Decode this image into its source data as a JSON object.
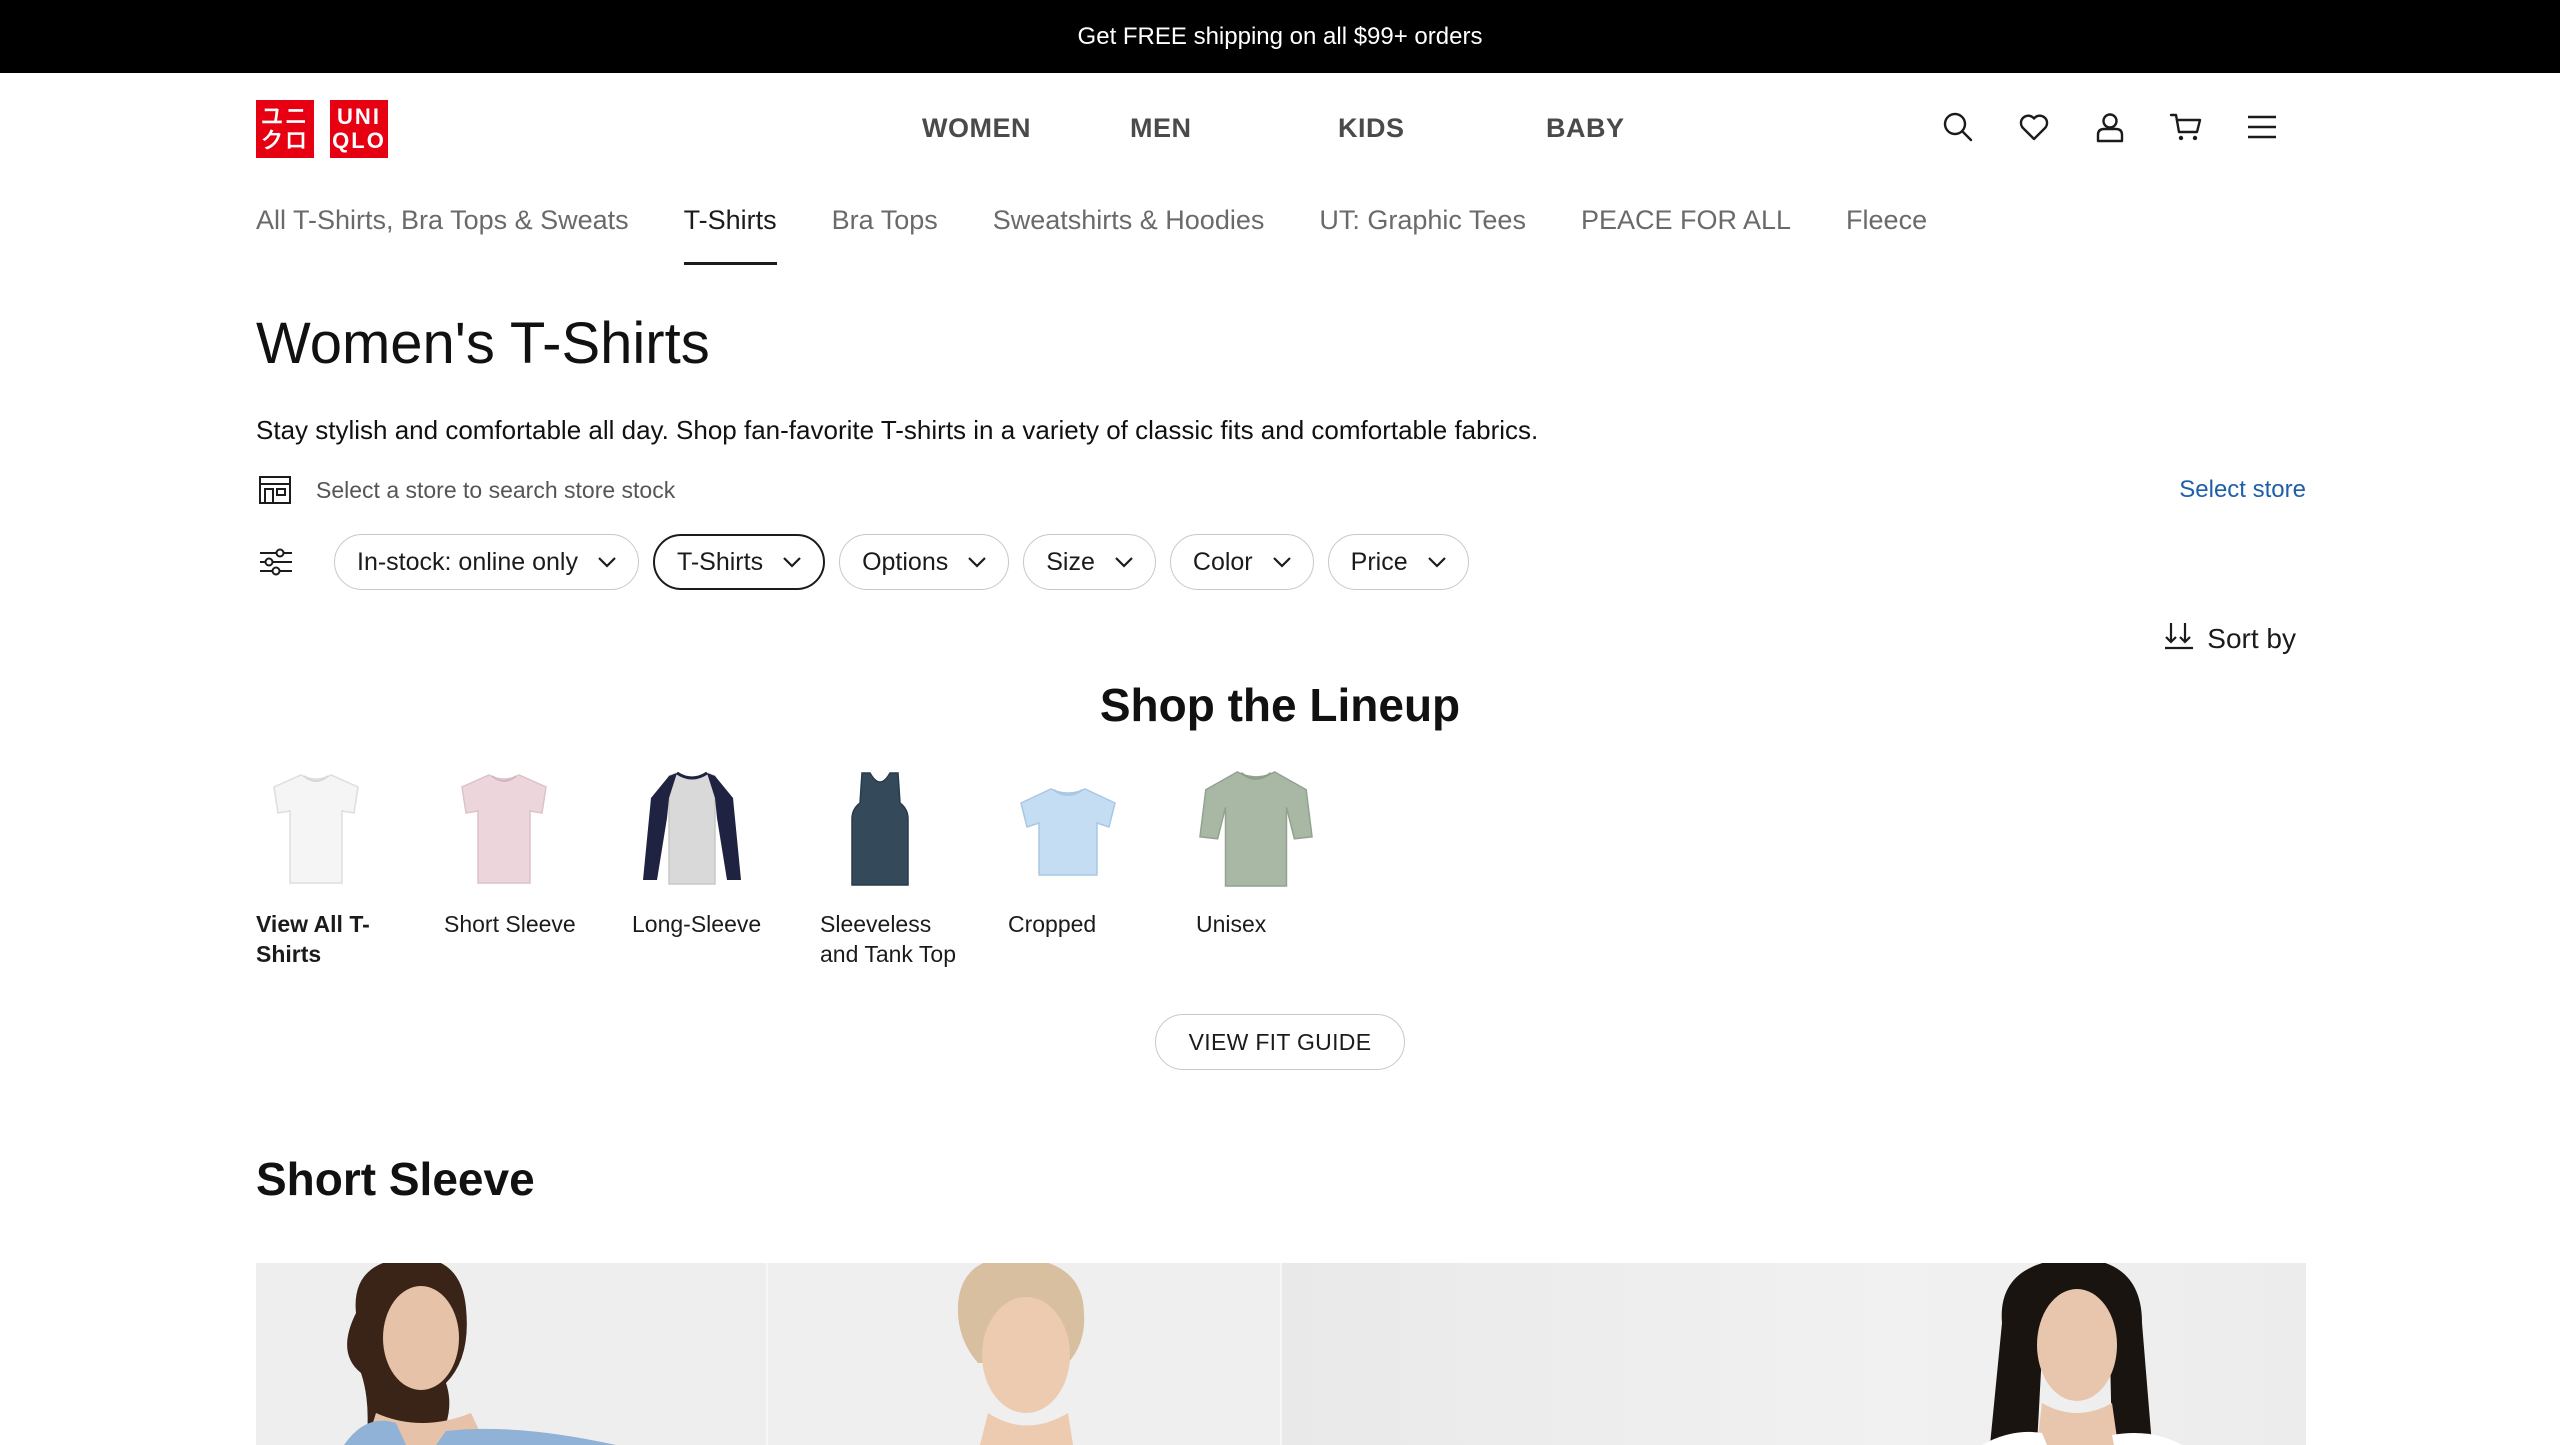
{
  "promo": {
    "text": "Get FREE shipping on all $99+ orders"
  },
  "logo": {
    "block1": [
      "ユニ",
      "クロ"
    ],
    "block2": [
      "UNI",
      "QLO"
    ]
  },
  "main_nav": [
    "WOMEN",
    "MEN",
    "KIDS",
    "BABY"
  ],
  "header_icons": [
    "search-icon",
    "heart-icon",
    "account-icon",
    "cart-icon",
    "menu-icon"
  ],
  "sub_nav": {
    "items": [
      "All T-Shirts, Bra Tops & Sweats",
      "T-Shirts",
      "Bra Tops",
      "Sweatshirts & Hoodies",
      "UT: Graphic Tees",
      "PEACE FOR ALL",
      "Fleece"
    ],
    "active": "T-Shirts"
  },
  "page": {
    "title": "Women's T-Shirts",
    "description": "Stay stylish and comfortable all day. Shop fan-favorite T-shirts in a variety of classic fits and comfortable fabrics."
  },
  "store": {
    "prompt": "Select a store to search store stock",
    "link": "Select store"
  },
  "filters": [
    {
      "label": "In-stock: online only",
      "selected": false
    },
    {
      "label": "T-Shirts",
      "selected": true
    },
    {
      "label": "Options",
      "selected": false
    },
    {
      "label": "Size",
      "selected": false
    },
    {
      "label": "Color",
      "selected": false
    },
    {
      "label": "Price",
      "selected": false
    }
  ],
  "sort": {
    "label": "Sort by"
  },
  "lineup": {
    "title": "Shop the Lineup",
    "items": [
      {
        "label": "View All T-Shirts",
        "color": "#f4f4f4"
      },
      {
        "label": "Short Sleeve",
        "color": "#ecd6dc"
      },
      {
        "label": "Long-Sleeve",
        "color": "#d9d9d9"
      },
      {
        "label": "Sleeveless and Tank Top",
        "color": "#34495a"
      },
      {
        "label": "Cropped",
        "color": "#c5ddf3"
      },
      {
        "label": "Unisex",
        "color": "#a9b7a5"
      }
    ],
    "fit_guide": "VIEW FIT GUIDE"
  },
  "section": {
    "title": "Short Sleeve"
  },
  "colors": {
    "promo_bg": "#000000",
    "logo_red": "#e60012",
    "link_blue": "#1d5fa8"
  }
}
